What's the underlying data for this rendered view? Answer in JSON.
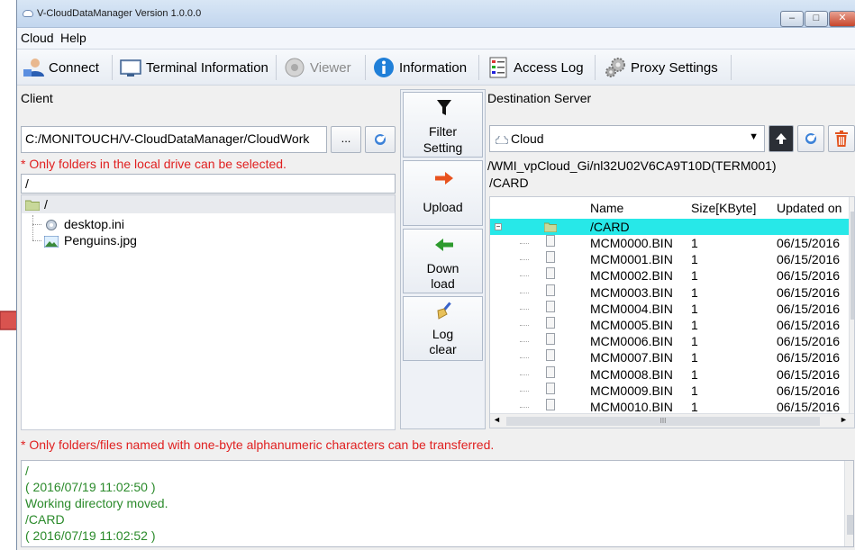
{
  "window": {
    "title": "V-CloudDataManager Version 1.0.0.0",
    "minimize": "–",
    "maximize": "□",
    "close": "✕"
  },
  "menu": [
    "Cloud",
    "Help"
  ],
  "toolbar": {
    "connect": "Connect",
    "terminal_info": "Terminal Information",
    "viewer": "Viewer",
    "information": "Information",
    "access_log": "Access Log",
    "proxy": "Proxy Settings"
  },
  "client": {
    "label": "Client",
    "path": "C:/MONITOUCH/V-CloudDataManager/CloudWork",
    "browse": "...",
    "note": "* Only folders in the local drive can be selected.",
    "current_folder": "/",
    "tree_root": "/",
    "files": [
      "desktop.ini",
      "Penguins.jpg"
    ]
  },
  "center": {
    "filter": [
      "Filter",
      "Setting"
    ],
    "upload": "Upload",
    "download": [
      "Down",
      "load"
    ],
    "log_clear": [
      "Log",
      "clear"
    ]
  },
  "server": {
    "label": "Destination Server",
    "selected": "Cloud",
    "path": "/WMI_vpCloud_Gi/nl32U02V6CA9T10D(TERM001)",
    "current_folder": "/CARD",
    "columns": [
      "Name",
      "Size[KByte]",
      "Updated on"
    ],
    "root_row": "/CARD",
    "rows": [
      {
        "name": "MCM0000.BIN",
        "size": "1",
        "date": "06/15/2016"
      },
      {
        "name": "MCM0001.BIN",
        "size": "1",
        "date": "06/15/2016"
      },
      {
        "name": "MCM0002.BIN",
        "size": "1",
        "date": "06/15/2016"
      },
      {
        "name": "MCM0003.BIN",
        "size": "1",
        "date": "06/15/2016"
      },
      {
        "name": "MCM0004.BIN",
        "size": "1",
        "date": "06/15/2016"
      },
      {
        "name": "MCM0005.BIN",
        "size": "1",
        "date": "06/15/2016"
      },
      {
        "name": "MCM0006.BIN",
        "size": "1",
        "date": "06/15/2016"
      },
      {
        "name": "MCM0007.BIN",
        "size": "1",
        "date": "06/15/2016"
      },
      {
        "name": "MCM0008.BIN",
        "size": "1",
        "date": "06/15/2016"
      },
      {
        "name": "MCM0009.BIN",
        "size": "1",
        "date": "06/15/2016"
      },
      {
        "name": "MCM0010.BIN",
        "size": "1",
        "date": "06/15/2016"
      }
    ],
    "hscroll_grip": "III"
  },
  "bottom_note": "* Only folders/files named with one-byte alphanumeric characters can be transferred.",
  "log": {
    "lines": [
      {
        "text": "/",
        "color": "#2a8a2a"
      },
      {
        "text": "( 2016/07/19 11:02:50 )",
        "color": "#2a8a2a"
      },
      {
        "text": "Working directory moved.",
        "color": "#2a8a2a"
      },
      {
        "text": "/CARD",
        "color": "#2a8a2a"
      },
      {
        "text": "( 2016/07/19 11:02:52 )",
        "color": "#2a8a2a"
      }
    ]
  },
  "colors": {
    "accent_red": "#e02020",
    "selection_cyan": "#27e8e8",
    "log_green": "#2a8a2a",
    "arrow_red": "#d9534f"
  }
}
